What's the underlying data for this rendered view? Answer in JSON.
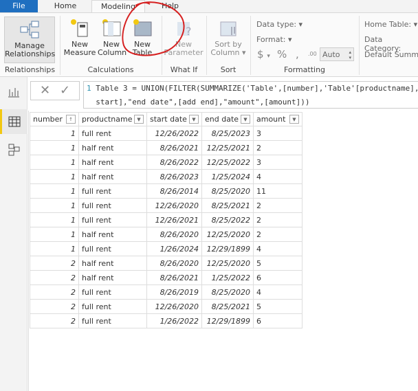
{
  "tabs": [
    "File",
    "Home",
    "Modeling",
    "Help"
  ],
  "ribbon": {
    "manage_relationships": "Manage Relationships",
    "new_measure": [
      "New",
      "Measure"
    ],
    "new_column": [
      "New",
      "Column"
    ],
    "new_table": [
      "New",
      "Table"
    ],
    "new_parameter": [
      "New",
      "Parameter"
    ],
    "sort_by_column": [
      "Sort by",
      "Column"
    ],
    "data_type": "Data type:",
    "format": "Format:",
    "currency": "$",
    "percent": "%",
    "comma": ",",
    "decimal": ".00",
    "auto": "Auto",
    "home_table": "Home Table:",
    "data_category": "Data Category:",
    "default_summarization": "Default Summa",
    "groups": [
      "Relationships",
      "Calculations",
      "What If",
      "Sort",
      "Formatting"
    ]
  },
  "formula": {
    "line_number": "1",
    "line1": "Table 3 = UNION(FILTER(SUMMARIZE('Table',[number],'Table'[productname],",
    "line2": "start],\"end date\",[add end],\"amount\",[amount]))"
  },
  "table": {
    "columns": [
      "number",
      "productname",
      "start date",
      "end date",
      "amount"
    ],
    "rows": [
      [
        "1",
        "full rent",
        "12/26/2022",
        "8/25/2023",
        "3"
      ],
      [
        "1",
        "half rent",
        "8/26/2021",
        "12/25/2021",
        "2"
      ],
      [
        "1",
        "half rent",
        "8/26/2022",
        "12/25/2022",
        "3"
      ],
      [
        "1",
        "half rent",
        "8/26/2023",
        "1/25/2024",
        "4"
      ],
      [
        "1",
        "full rent",
        "8/26/2014",
        "8/25/2020",
        "11"
      ],
      [
        "1",
        "full rent",
        "12/26/2020",
        "8/25/2021",
        "2"
      ],
      [
        "1",
        "full rent",
        "12/26/2021",
        "8/25/2022",
        "2"
      ],
      [
        "1",
        "half rent",
        "8/26/2020",
        "12/25/2020",
        "2"
      ],
      [
        "1",
        "full rent",
        "1/26/2024",
        "12/29/1899",
        "4"
      ],
      [
        "2",
        "half rent",
        "8/26/2020",
        "12/25/2020",
        "5"
      ],
      [
        "2",
        "half rent",
        "8/26/2021",
        "1/25/2022",
        "6"
      ],
      [
        "2",
        "full rent",
        "8/26/2019",
        "8/25/2020",
        "4"
      ],
      [
        "2",
        "full rent",
        "12/26/2020",
        "8/25/2021",
        "5"
      ],
      [
        "2",
        "full rent",
        "1/26/2022",
        "12/29/1899",
        "6"
      ]
    ]
  },
  "colors": {
    "file_tab": "#1f6fc0",
    "annotation": "#d62020",
    "active_view": "#f2c811"
  }
}
